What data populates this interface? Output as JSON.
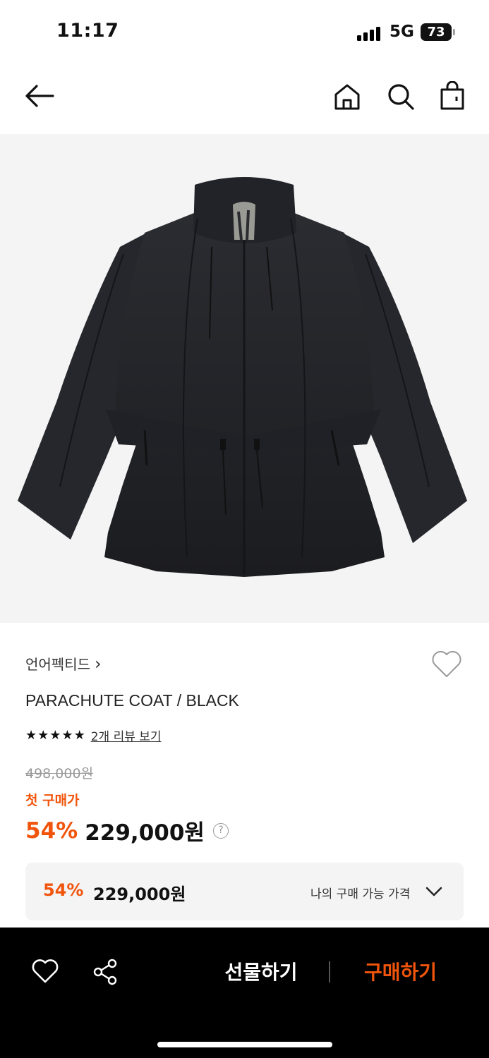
{
  "status": {
    "time": "11:17",
    "network": "5G",
    "battery": "73"
  },
  "nav": {
    "back_icon": "arrow-left-icon",
    "home_icon": "home-icon",
    "search_icon": "search-icon",
    "cart_icon": "shopping-bag-icon"
  },
  "product": {
    "image_alt": "black parachute coat",
    "brand": "언어펙티드",
    "brand_arrow": "›",
    "name": "PARACHUTE COAT / BLACK",
    "rating": 5,
    "stars": [
      "★",
      "★",
      "★",
      "★",
      "★"
    ],
    "review_link": "2개 리뷰 보기",
    "original_price": "498,000원",
    "first_purchase_label": "첫 구매가",
    "discount": "54%",
    "sale_price": "229,000원",
    "help": "?"
  },
  "my_price": {
    "discount": "54%",
    "price": "229,000원",
    "label": "나의 구매 가능 가격"
  },
  "bottom": {
    "gift_label": "선물하기",
    "buy_label": "구매하기"
  },
  "colors": {
    "accent": "#f1550c",
    "background": "#ffffff",
    "bottom_bar": "#000000"
  }
}
